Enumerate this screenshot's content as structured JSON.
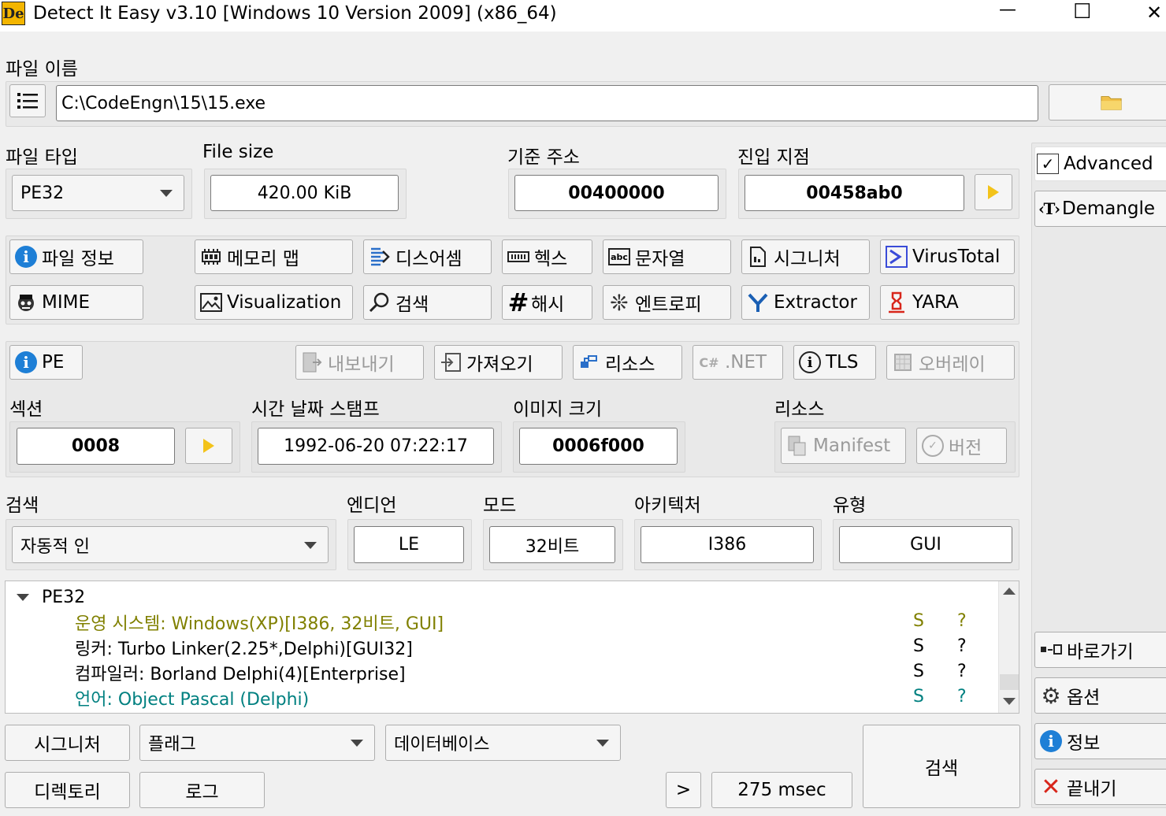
{
  "window": {
    "title": "Detect It Easy v3.10 [Windows 10 Version 2009] (x86_64)",
    "logo_text": "De",
    "minimize_glyph": "—",
    "maximize_glyph": "☐",
    "close_glyph": "✕"
  },
  "file": {
    "label": "파일 이름",
    "path": "C:\\CodeEngn\\15\\15.exe"
  },
  "info_row": {
    "file_type_label": "파일 타입",
    "file_type_value": "PE32",
    "file_size_label": "File size",
    "file_size_value": "420.00 KiB",
    "base_address_label": "기준 주소",
    "base_address_value": "00400000",
    "entry_point_label": "진입 지점",
    "entry_point_value": "00458ab0"
  },
  "side": {
    "advanced_label": "Advanced",
    "advanced_checked": true,
    "demangle_label": "Demangle",
    "shortcuts_label": "바로가기",
    "options_label": "옵션",
    "about_label": "정보",
    "exit_label": "끝내기"
  },
  "tools": {
    "file_info": "파일 정보",
    "memory_map": "메모리 맵",
    "disasm": "디스어셈",
    "hex": "헥스",
    "strings": "문자열",
    "signatures": "시그니처",
    "virustotal": "VirusTotal",
    "mime": "MIME",
    "visualization": "Visualization",
    "search": "검색",
    "hash": "해시",
    "entropy": "엔트로피",
    "extractor": "Extractor",
    "yara": "YARA"
  },
  "pe": {
    "pe_label": "PE",
    "export": "내보내기",
    "import": "가져오기",
    "resources": "리소스",
    "net": ".NET",
    "tls": "TLS",
    "overlay": "오버레이",
    "sections_label": "섹션",
    "sections_value": "0008",
    "timestamp_label": "시간 날짜 스탬프",
    "timestamp_value": "1992-06-20 07:22:17",
    "image_size_label": "이미지 크기",
    "image_size_value": "0006f000",
    "resources_label": "리소스",
    "manifest": "Manifest",
    "version": "버전"
  },
  "scan": {
    "scan_label": "검색",
    "scan_mode": "자동적 인",
    "endian_label": "엔디언",
    "endian_value": "LE",
    "mode_label": "모드",
    "mode_value": "32비트",
    "arch_label": "아키텍처",
    "arch_value": "I386",
    "type_label": "유형",
    "type_value": "GUI"
  },
  "results": {
    "root": "PE32",
    "rows": [
      {
        "text": "운영 시스템: Windows(XP)[I386, 32비트, GUI]",
        "s": "S",
        "q": "?",
        "color": "#808000"
      },
      {
        "text": "링커: Turbo Linker(2.25*,Delphi)[GUI32]",
        "s": "S",
        "q": "?",
        "color": "#000000"
      },
      {
        "text": "컴파일러: Borland Delphi(4)[Enterprise]",
        "s": "S",
        "q": "?",
        "color": "#000000"
      },
      {
        "text": "언어: Object Pascal (Delphi)",
        "s": "S",
        "q": "?",
        "color": "#008080"
      }
    ]
  },
  "bottom": {
    "signatures": "시그니처",
    "flags": "플래그",
    "database": "데이터베이스",
    "directory": "디렉토리",
    "log": "로그",
    "more": ">",
    "time": "275 msec",
    "scan_button": "검색"
  },
  "colors": {
    "window_bg": "#f0f0f0",
    "group_bg": "#e9e9e9",
    "olive_text": "#808000",
    "teal_text": "#008080",
    "info_blue": "#1e7fd6",
    "arrow_yellow": "#f3c31a"
  }
}
